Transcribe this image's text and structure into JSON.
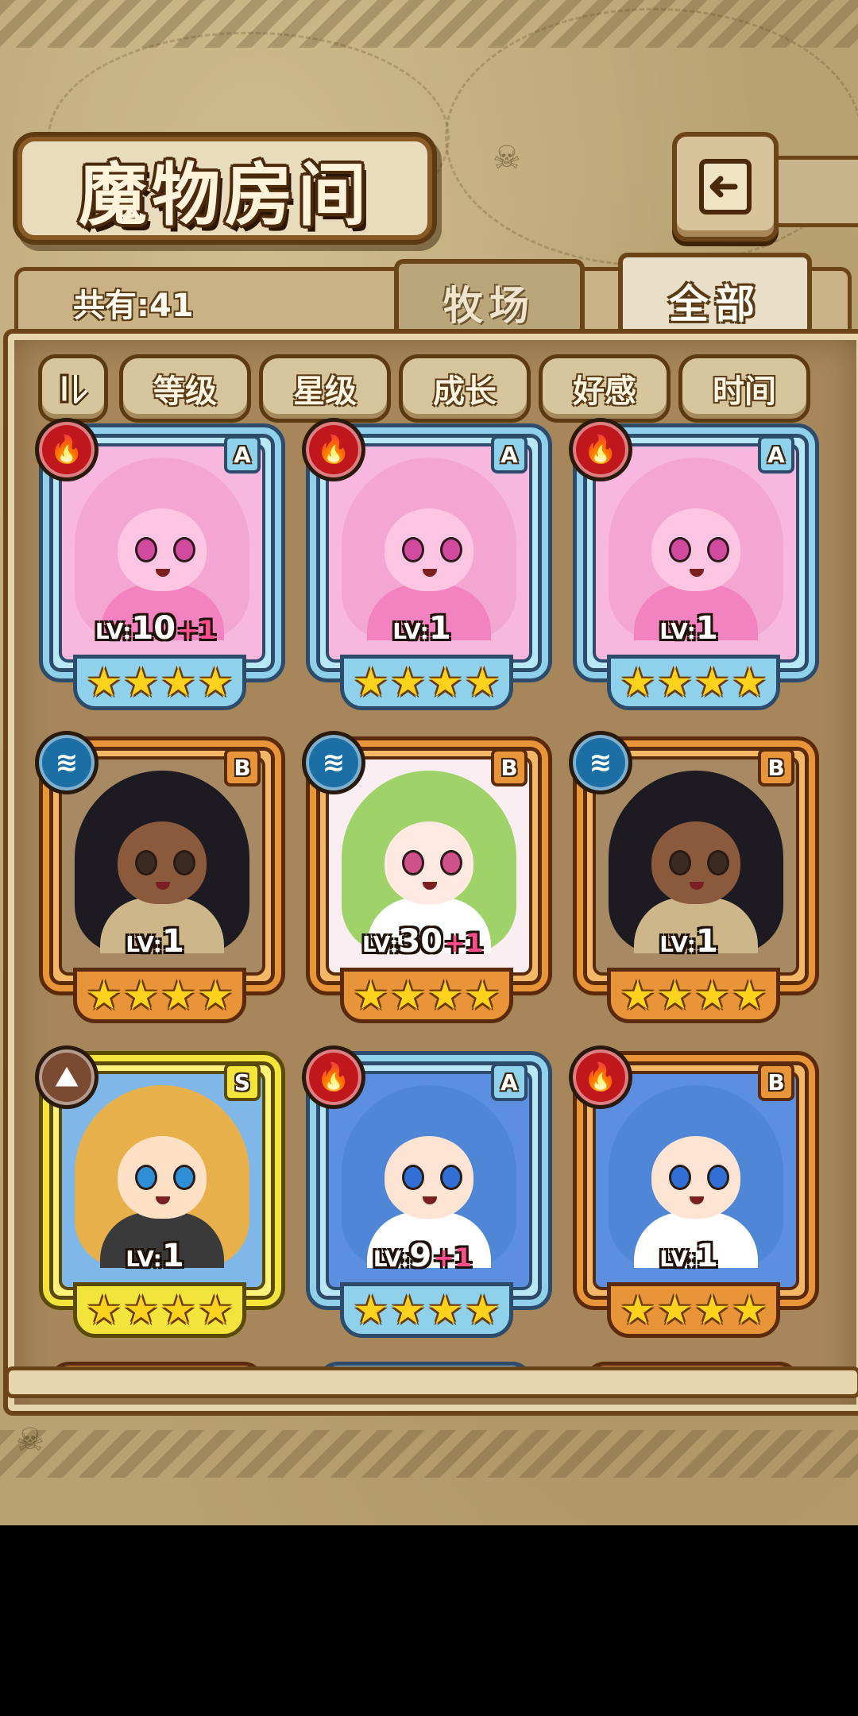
{
  "header": {
    "title": "魔物房间"
  },
  "summary": {
    "count_label": "共有:41"
  },
  "tabs": [
    {
      "label": "牧场",
      "active": false
    },
    {
      "label": "全部",
      "active": true
    }
  ],
  "sort_buttons": [
    "等级",
    "星级",
    "成长",
    "好感",
    "时间"
  ],
  "cards": [
    {
      "frame": "blue",
      "element": "fire",
      "rank": "A",
      "level_prefix": "LV:",
      "level": "10",
      "bonus": "+1",
      "stars": 4,
      "hair": "#f4a6d2",
      "skin": "#ffc6e4",
      "eye": "#d04aa0",
      "cloth": "#f283c0",
      "inner": "#f7b7df"
    },
    {
      "frame": "blue",
      "element": "fire",
      "rank": "A",
      "level_prefix": "LV:",
      "level": "1",
      "bonus": "",
      "stars": 4,
      "hair": "#f4a6d2",
      "skin": "#ffc6e4",
      "eye": "#d04aa0",
      "cloth": "#f283c0",
      "inner": "#f7b7df"
    },
    {
      "frame": "blue",
      "element": "fire",
      "rank": "A",
      "level_prefix": "LV:",
      "level": "1",
      "bonus": "",
      "stars": 4,
      "hair": "#f4a6d2",
      "skin": "#ffc6e4",
      "eye": "#d04aa0",
      "cloth": "#f283c0",
      "inner": "#f7b7df"
    },
    {
      "frame": "orange",
      "element": "water",
      "rank": "B",
      "level_prefix": "LV:",
      "level": "1",
      "bonus": "",
      "stars": 4,
      "hair": "#1d1a22",
      "skin": "#8b5a3c",
      "eye": "#3b2a20",
      "cloth": "#ccb68a",
      "inner": "#a78a63"
    },
    {
      "frame": "orange",
      "element": "water",
      "rank": "B",
      "level_prefix": "LV:",
      "level": "30",
      "bonus": "+1",
      "stars": 4,
      "hair": "#9fd36a",
      "skin": "#ffe9e0",
      "eye": "#d0508a",
      "cloth": "#ffffff",
      "inner": "#fbeef2"
    },
    {
      "frame": "orange",
      "element": "water",
      "rank": "B",
      "level_prefix": "LV:",
      "level": "1",
      "bonus": "",
      "stars": 4,
      "hair": "#1d1a22",
      "skin": "#8b5a3c",
      "eye": "#3b2a20",
      "cloth": "#ccb68a",
      "inner": "#a78a63"
    },
    {
      "frame": "gold",
      "element": "earth",
      "rank": "S",
      "level_prefix": "LV:",
      "level": "1",
      "bonus": "",
      "stars": 4,
      "hair": "#e8b04a",
      "skin": "#ffe0c4",
      "eye": "#2f8fd6",
      "cloth": "#3a3a3a",
      "inner": "#7fb8e8"
    },
    {
      "frame": "blue",
      "element": "fire",
      "rank": "A",
      "level_prefix": "LV:",
      "level": "9",
      "bonus": "+1",
      "stars": 4,
      "hair": "#4f86d6",
      "skin": "#ffe4d4",
      "eye": "#2f6fd6",
      "cloth": "#ffffff",
      "inner": "#5c8fe0"
    },
    {
      "frame": "orange",
      "element": "fire",
      "rank": "B",
      "level_prefix": "LV:",
      "level": "1",
      "bonus": "",
      "stars": 4,
      "hair": "#4f86d6",
      "skin": "#ffe4d4",
      "eye": "#2f6fd6",
      "cloth": "#ffffff",
      "inner": "#5c8fe0"
    }
  ],
  "element_colors": {
    "fire": "#c0171d",
    "water": "#1b6fa6",
    "earth": "#7a4a32"
  },
  "element_icons": {
    "fire": "fire-icon",
    "water": "water-wave-icon",
    "earth": "mountain-icon"
  }
}
